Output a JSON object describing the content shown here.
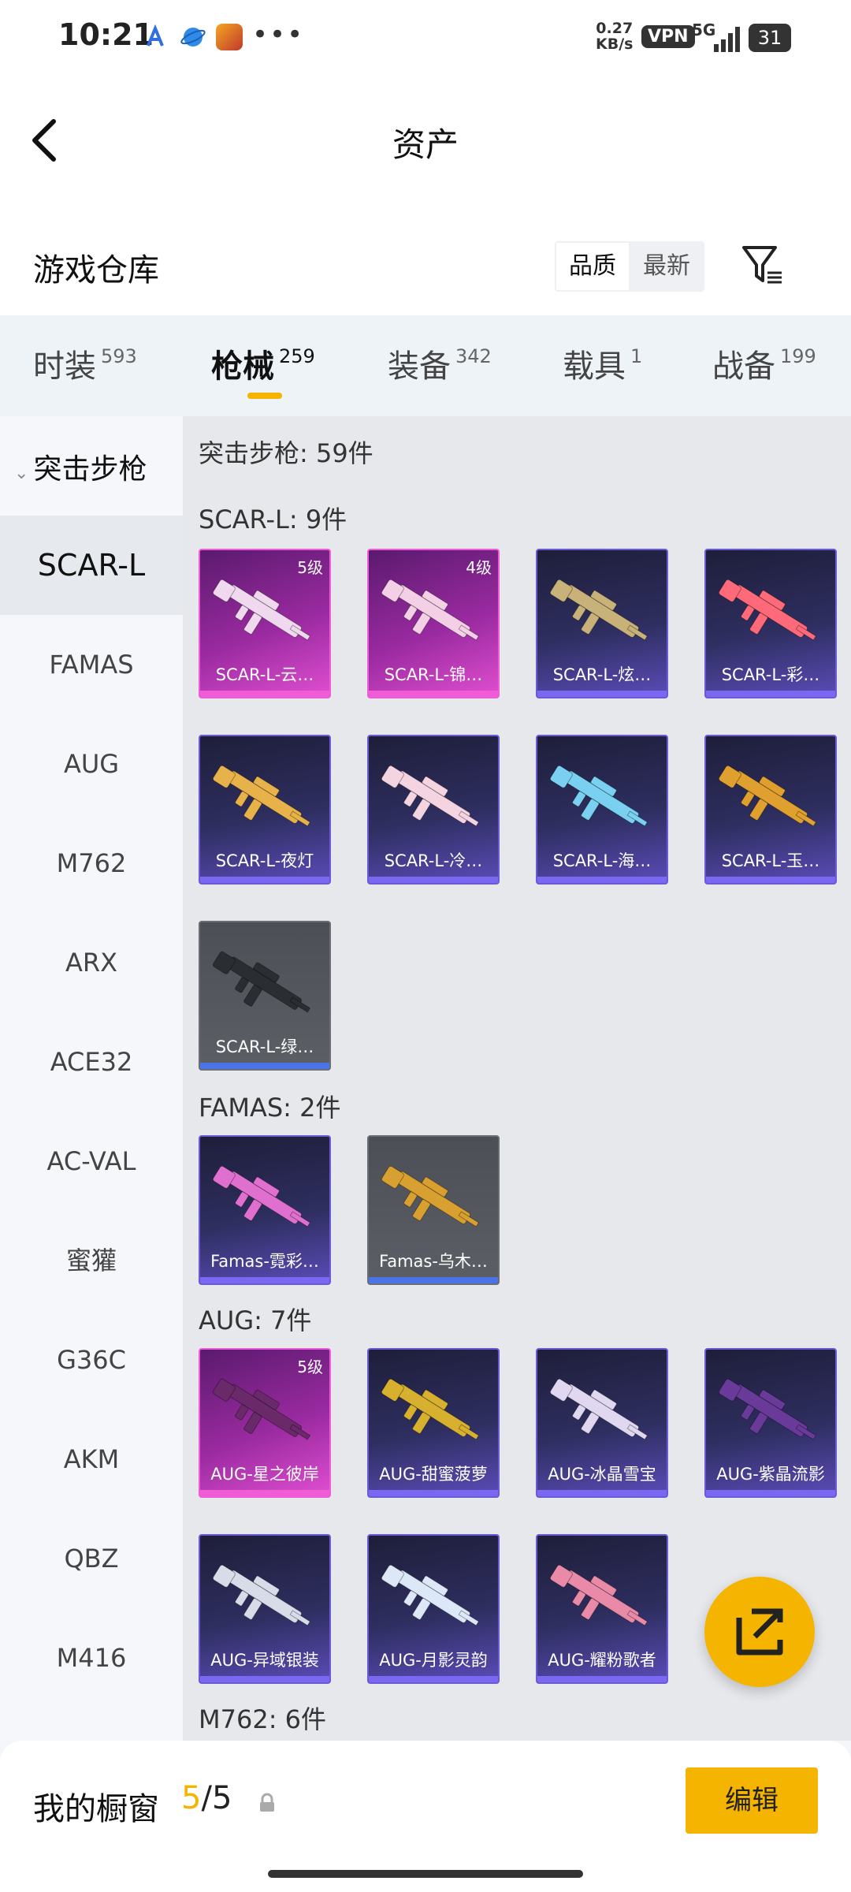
{
  "status_bar": {
    "time": "10:21",
    "speed": "0.27",
    "speed_unit": "KB/s",
    "vpn": "VPN",
    "network": "5G",
    "battery": "31"
  },
  "header": {
    "title": "资产"
  },
  "warehouse": {
    "title": "游戏仓库",
    "sort_quality": "品质",
    "sort_latest": "最新"
  },
  "categories": [
    {
      "label": "时装",
      "count": "593"
    },
    {
      "label": "枪械",
      "count": "259"
    },
    {
      "label": "装备",
      "count": "342"
    },
    {
      "label": "载具",
      "count": "1"
    },
    {
      "label": "战备",
      "count": "199"
    }
  ],
  "sidebar": {
    "header": "突击步枪",
    "items": [
      "SCAR-L",
      "FAMAS",
      "AUG",
      "M762",
      "ARX",
      "ACE32",
      "AC-VAL",
      "蜜獾",
      "G36C",
      "AKM",
      "QBZ",
      "M416"
    ]
  },
  "content": {
    "summary": "突击步枪: 59件",
    "sections": [
      {
        "title": "SCAR-L: 9件",
        "items": [
          {
            "name": "SCAR-L-云…",
            "level": "5级"
          },
          {
            "name": "SCAR-L-锦…",
            "level": "4级"
          },
          {
            "name": "SCAR-L-炫…"
          },
          {
            "name": "SCAR-L-彩…"
          },
          {
            "name": "SCAR-L-夜灯"
          },
          {
            "name": "SCAR-L-冷…"
          },
          {
            "name": "SCAR-L-海…"
          },
          {
            "name": "SCAR-L-玉…"
          },
          {
            "name": "SCAR-L-绿…"
          }
        ]
      },
      {
        "title": "FAMAS: 2件",
        "items": [
          {
            "name": "Famas-霓彩…"
          },
          {
            "name": "Famas-乌木…"
          }
        ]
      },
      {
        "title": "AUG: 7件",
        "items": [
          {
            "name": "AUG-星之彼岸",
            "level": "5级"
          },
          {
            "name": "AUG-甜蜜菠萝"
          },
          {
            "name": "AUG-冰晶雪宝"
          },
          {
            "name": "AUG-紫晶流影"
          },
          {
            "name": "AUG-异域银装"
          },
          {
            "name": "AUG-月影灵韵"
          },
          {
            "name": "AUG-耀粉歌者"
          }
        ]
      },
      {
        "title": "M762: 6件",
        "items": []
      }
    ]
  },
  "bottom_bar": {
    "label": "我的橱窗",
    "count_current": "5",
    "count_sep": "/",
    "count_total": "5",
    "edit": "编辑"
  },
  "colors": {
    "accent": "#f5b400",
    "quality_legendary": "#e04fd0",
    "quality_epic": "#6a5ad8",
    "quality_common": "#5c5f66"
  }
}
